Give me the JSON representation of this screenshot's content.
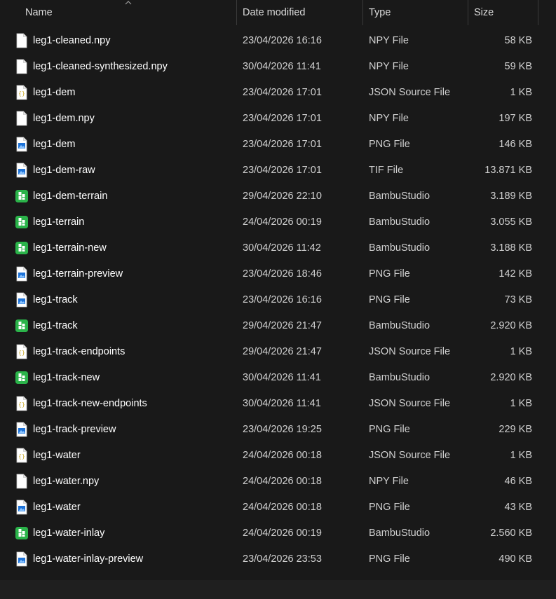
{
  "columns": {
    "name": "Name",
    "date": "Date modified",
    "type": "Type",
    "size": "Size"
  },
  "colors": {
    "background": "#191919",
    "text": "#ffffff",
    "subtext": "#d0d0d0",
    "bambu_green": "#2bb34a",
    "png_blue": "#1e73d8"
  },
  "files": [
    {
      "name": "leg1-cleaned.npy",
      "date": "23/04/2026 16:16",
      "type": "NPY File",
      "size": "58 KB",
      "icon": "blank-file-icon"
    },
    {
      "name": "leg1-cleaned-synthesized.npy",
      "date": "30/04/2026 11:41",
      "type": "NPY File",
      "size": "59 KB",
      "icon": "blank-file-icon"
    },
    {
      "name": "leg1-dem",
      "date": "23/04/2026 17:01",
      "type": "JSON Source File",
      "size": "1 KB",
      "icon": "json-file-icon"
    },
    {
      "name": "leg1-dem.npy",
      "date": "23/04/2026 17:01",
      "type": "NPY File",
      "size": "197 KB",
      "icon": "blank-file-icon"
    },
    {
      "name": "leg1-dem",
      "date": "23/04/2026 17:01",
      "type": "PNG File",
      "size": "146 KB",
      "icon": "image-file-icon"
    },
    {
      "name": "leg1-dem-raw",
      "date": "23/04/2026 17:01",
      "type": "TIF File",
      "size": "13.871 KB",
      "icon": "image-file-icon"
    },
    {
      "name": "leg1-dem-terrain",
      "date": "29/04/2026 22:10",
      "type": "BambuStudio",
      "size": "3.189 KB",
      "icon": "bambu-studio-icon"
    },
    {
      "name": "leg1-terrain",
      "date": "24/04/2026 00:19",
      "type": "BambuStudio",
      "size": "3.055 KB",
      "icon": "bambu-studio-icon"
    },
    {
      "name": "leg1-terrain-new",
      "date": "30/04/2026 11:42",
      "type": "BambuStudio",
      "size": "3.188 KB",
      "icon": "bambu-studio-icon"
    },
    {
      "name": "leg1-terrain-preview",
      "date": "23/04/2026 18:46",
      "type": "PNG File",
      "size": "142 KB",
      "icon": "image-file-icon"
    },
    {
      "name": "leg1-track",
      "date": "23/04/2026 16:16",
      "type": "PNG File",
      "size": "73 KB",
      "icon": "image-file-icon"
    },
    {
      "name": "leg1-track",
      "date": "29/04/2026 21:47",
      "type": "BambuStudio",
      "size": "2.920 KB",
      "icon": "bambu-studio-icon"
    },
    {
      "name": "leg1-track-endpoints",
      "date": "29/04/2026 21:47",
      "type": "JSON Source File",
      "size": "1 KB",
      "icon": "json-file-icon"
    },
    {
      "name": "leg1-track-new",
      "date": "30/04/2026 11:41",
      "type": "BambuStudio",
      "size": "2.920 KB",
      "icon": "bambu-studio-icon"
    },
    {
      "name": "leg1-track-new-endpoints",
      "date": "30/04/2026 11:41",
      "type": "JSON Source File",
      "size": "1 KB",
      "icon": "json-file-icon"
    },
    {
      "name": "leg1-track-preview",
      "date": "23/04/2026 19:25",
      "type": "PNG File",
      "size": "229 KB",
      "icon": "image-file-icon"
    },
    {
      "name": "leg1-water",
      "date": "24/04/2026 00:18",
      "type": "JSON Source File",
      "size": "1 KB",
      "icon": "json-file-icon"
    },
    {
      "name": "leg1-water.npy",
      "date": "24/04/2026 00:18",
      "type": "NPY File",
      "size": "46 KB",
      "icon": "blank-file-icon"
    },
    {
      "name": "leg1-water",
      "date": "24/04/2026 00:18",
      "type": "PNG File",
      "size": "43 KB",
      "icon": "image-file-icon"
    },
    {
      "name": "leg1-water-inlay",
      "date": "24/04/2026 00:19",
      "type": "BambuStudio",
      "size": "2.560 KB",
      "icon": "bambu-studio-icon"
    },
    {
      "name": "leg1-water-inlay-preview",
      "date": "23/04/2026 23:53",
      "type": "PNG File",
      "size": "490 KB",
      "icon": "image-file-icon"
    }
  ]
}
